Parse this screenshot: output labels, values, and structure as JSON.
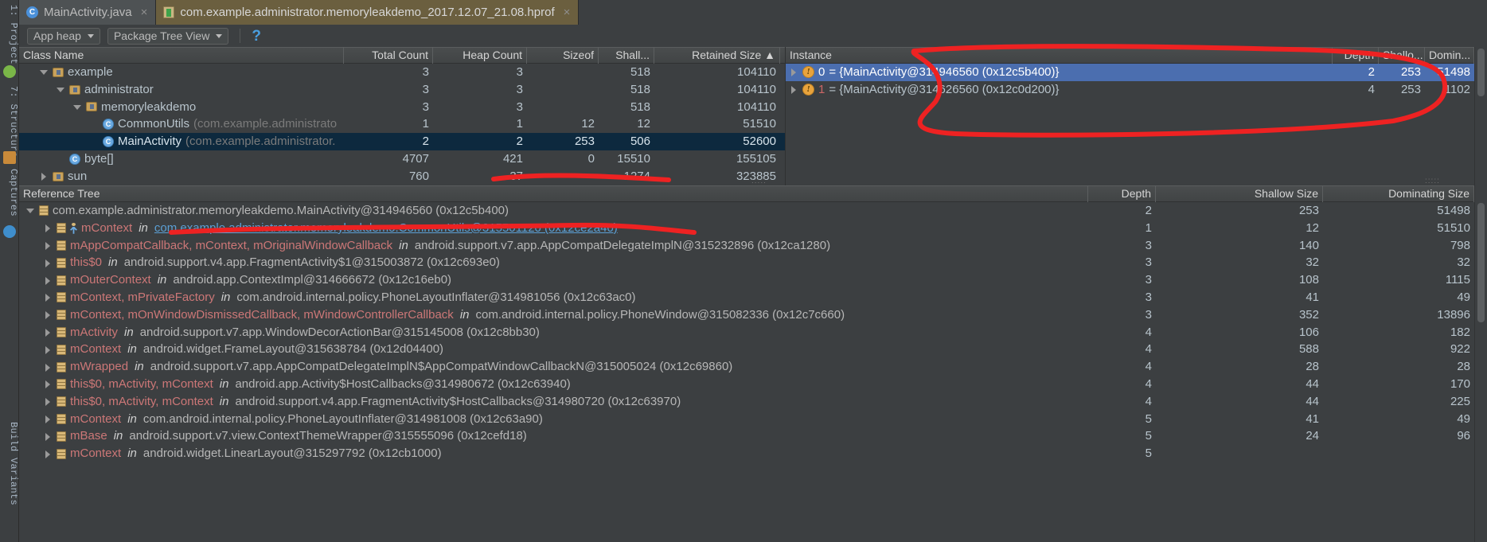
{
  "window": {
    "app": "Android Studio Memory Monitor / HPROF Viewer"
  },
  "tabs": [
    {
      "label": "MainActivity.java",
      "icon": "java-class-icon",
      "close": "×",
      "active": false
    },
    {
      "label": "com.example.administrator.memoryleakdemo_2017.12.07_21.08.hprof",
      "icon": "hprof-file-icon",
      "close": "×",
      "active": true
    }
  ],
  "toolbar": {
    "heap_select": "App heap",
    "view_select": "Package Tree View",
    "help_icon": "?"
  },
  "rail": [
    {
      "label": "1: Project"
    },
    {
      "label": "7: Structure"
    },
    {
      "label": "Captures"
    },
    {
      "label": "Build Variants"
    }
  ],
  "class_table": {
    "columns": [
      "Class Name",
      "Total Count",
      "Heap Count",
      "Sizeof",
      "Shall...",
      "Retained Size ▲"
    ],
    "rows": [
      {
        "indent": 1,
        "twisty": "open",
        "icon": "package-icon",
        "name": "example",
        "tail": "",
        "total": "3",
        "heap": "3",
        "sizeof": "",
        "shallow": "518",
        "retained": "104110",
        "selected": false
      },
      {
        "indent": 2,
        "twisty": "open",
        "icon": "package-icon",
        "name": "administrator",
        "tail": "",
        "total": "3",
        "heap": "3",
        "sizeof": "",
        "shallow": "518",
        "retained": "104110",
        "selected": false
      },
      {
        "indent": 3,
        "twisty": "open",
        "icon": "package-icon",
        "name": "memoryleakdemo",
        "tail": "",
        "total": "3",
        "heap": "3",
        "sizeof": "",
        "shallow": "518",
        "retained": "104110",
        "selected": false
      },
      {
        "indent": 4,
        "twisty": "none",
        "icon": "class-icon",
        "name": "CommonUtils",
        "tail": "(com.example.administrato",
        "total": "1",
        "heap": "1",
        "sizeof": "12",
        "shallow": "12",
        "retained": "51510",
        "selected": false
      },
      {
        "indent": 4,
        "twisty": "none",
        "icon": "class-icon",
        "name": "MainActivity",
        "tail": "(com.example.administrator.",
        "total": "2",
        "heap": "2",
        "sizeof": "253",
        "shallow": "506",
        "retained": "52600",
        "selected": true
      },
      {
        "indent": 2,
        "twisty": "none",
        "icon": "class-icon",
        "name": "byte[]",
        "tail": "",
        "total": "4707",
        "heap": "421",
        "sizeof": "0",
        "shallow": "15510",
        "retained": "155105",
        "selected": false
      },
      {
        "indent": 1,
        "twisty": "closed",
        "icon": "package-icon",
        "name": "sun",
        "tail": "",
        "total": "760",
        "heap": "37",
        "sizeof": "",
        "shallow": "1274",
        "retained": "323885",
        "selected": false
      }
    ]
  },
  "instance_table": {
    "columns": [
      "Instance",
      "Depth",
      "Shallo...",
      "Domin..."
    ],
    "rows": [
      {
        "index": "0",
        "text": " = {MainActivity@314946560 (0x12c5b400)}",
        "depth": "2",
        "shallow": "253",
        "dominating": "51498",
        "selected": true
      },
      {
        "index": "1",
        "text": " = {MainActivity@314626560 (0x12c0d200)}",
        "depth": "4",
        "shallow": "253",
        "dominating": "1102",
        "selected": false
      }
    ]
  },
  "reference_tree": {
    "columns": [
      "Reference Tree",
      "Depth",
      "Shallow Size",
      "Dominating Size"
    ],
    "rows": [
      {
        "indent": 0,
        "twisty": "open",
        "icon": "ref-icon",
        "fields": "",
        "in": "",
        "cls": "com.example.administrator.memoryleakdemo.MainActivity@314946560 (0x12c5b400)",
        "link": false,
        "depth": "2",
        "shallow": "253",
        "dominating": "51498"
      },
      {
        "indent": 1,
        "twisty": "closed",
        "icon": "gc-root-icon",
        "fields": "mContext",
        "in": "in",
        "cls": "com.example.administrator.memoryleakdemo.CommonUtils@315501120 (0x12ce2a40)",
        "link": true,
        "depth": "1",
        "shallow": "12",
        "dominating": "51510"
      },
      {
        "indent": 1,
        "twisty": "closed",
        "icon": "ref-icon",
        "fields": "mAppCompatCallback, mContext, mOriginalWindowCallback",
        "in": "in",
        "cls": "android.support.v7.app.AppCompatDelegateImplN@315232896 (0x12ca1280)",
        "link": false,
        "depth": "3",
        "shallow": "140",
        "dominating": "798"
      },
      {
        "indent": 1,
        "twisty": "closed",
        "icon": "ref-icon",
        "fields": "this$0",
        "in": "in",
        "cls": "android.support.v4.app.FragmentActivity$1@315003872 (0x12c693e0)",
        "link": false,
        "depth": "3",
        "shallow": "32",
        "dominating": "32"
      },
      {
        "indent": 1,
        "twisty": "closed",
        "icon": "ref-icon",
        "fields": "mOuterContext",
        "in": "in",
        "cls": "android.app.ContextImpl@314666672 (0x12c16eb0)",
        "link": false,
        "depth": "3",
        "shallow": "108",
        "dominating": "1115"
      },
      {
        "indent": 1,
        "twisty": "closed",
        "icon": "ref-icon",
        "fields": "mContext, mPrivateFactory",
        "in": "in",
        "cls": "com.android.internal.policy.PhoneLayoutInflater@314981056 (0x12c63ac0)",
        "link": false,
        "depth": "3",
        "shallow": "41",
        "dominating": "49"
      },
      {
        "indent": 1,
        "twisty": "closed",
        "icon": "ref-icon",
        "fields": "mContext, mOnWindowDismissedCallback, mWindowControllerCallback",
        "in": "in",
        "cls": "com.android.internal.policy.PhoneWindow@315082336 (0x12c7c660)",
        "link": false,
        "depth": "3",
        "shallow": "352",
        "dominating": "13896"
      },
      {
        "indent": 1,
        "twisty": "closed",
        "icon": "ref-icon",
        "fields": "mActivity",
        "in": "in",
        "cls": "android.support.v7.app.WindowDecorActionBar@315145008 (0x12c8bb30)",
        "link": false,
        "depth": "4",
        "shallow": "106",
        "dominating": "182"
      },
      {
        "indent": 1,
        "twisty": "closed",
        "icon": "ref-icon",
        "fields": "mContext",
        "in": "in",
        "cls": "android.widget.FrameLayout@315638784 (0x12d04400)",
        "link": false,
        "depth": "4",
        "shallow": "588",
        "dominating": "922"
      },
      {
        "indent": 1,
        "twisty": "closed",
        "icon": "ref-icon",
        "fields": "mWrapped",
        "in": "in",
        "cls": "android.support.v7.app.AppCompatDelegateImplN$AppCompatWindowCallbackN@315005024 (0x12c69860)",
        "link": false,
        "depth": "4",
        "shallow": "28",
        "dominating": "28"
      },
      {
        "indent": 1,
        "twisty": "closed",
        "icon": "ref-icon",
        "fields": "this$0, mActivity, mContext",
        "in": "in",
        "cls": "android.app.Activity$HostCallbacks@314980672 (0x12c63940)",
        "link": false,
        "depth": "4",
        "shallow": "44",
        "dominating": "170"
      },
      {
        "indent": 1,
        "twisty": "closed",
        "icon": "ref-icon",
        "fields": "this$0, mActivity, mContext",
        "in": "in",
        "cls": "android.support.v4.app.FragmentActivity$HostCallbacks@314980720 (0x12c63970)",
        "link": false,
        "depth": "4",
        "shallow": "44",
        "dominating": "225"
      },
      {
        "indent": 1,
        "twisty": "closed",
        "icon": "ref-icon",
        "fields": "mContext",
        "in": "in",
        "cls": "com.android.internal.policy.PhoneLayoutInflater@314981008 (0x12c63a90)",
        "link": false,
        "depth": "5",
        "shallow": "41",
        "dominating": "49"
      },
      {
        "indent": 1,
        "twisty": "closed",
        "icon": "ref-icon",
        "fields": "mBase",
        "in": "in",
        "cls": "android.support.v7.view.ContextThemeWrapper@315555096 (0x12cefd18)",
        "link": false,
        "depth": "5",
        "shallow": "24",
        "dominating": "96"
      },
      {
        "indent": 1,
        "twisty": "closed",
        "icon": "ref-icon",
        "fields": "mContext",
        "in": "in",
        "cls": "android.widget.LinearLayout@315297792 (0x12cb1000)",
        "link": false,
        "depth": "5",
        "shallow": "",
        "dominating": ""
      }
    ]
  },
  "colors": {
    "accent_selection": "#4b6eaf",
    "row_selection": "#0d293e",
    "annotation": "#ee2222",
    "field_text": "#cc7777",
    "link_text": "#5b9fd4"
  }
}
